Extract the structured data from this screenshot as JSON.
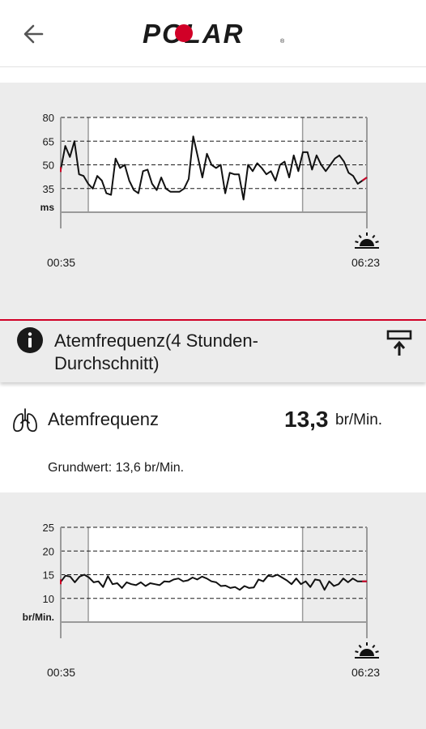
{
  "header": {
    "back_icon": "arrow-left-icon",
    "logo_text": "POLAR",
    "logo_color": "#1a1a1a",
    "logo_accent": "#d10027"
  },
  "hrv_chart": {
    "chart_data": {
      "type": "line",
      "ylabel": "ms",
      "yticks": [
        "80",
        "65",
        "50",
        "35"
      ],
      "ylim": [
        20,
        80
      ],
      "x_start_label": "00:35",
      "x_end_label": "06:23",
      "x_start_icon": "moon-icon",
      "x_end_icon": "sunrise-icon",
      "sleep_window_fraction": [
        0.09,
        0.79
      ],
      "values": [
        47,
        62,
        55,
        65,
        44,
        43,
        38,
        35,
        43,
        40,
        32,
        31,
        54,
        48,
        50,
        40,
        34,
        32,
        46,
        47,
        38,
        34,
        42,
        35,
        33,
        33,
        33,
        35,
        41,
        68,
        55,
        42,
        57,
        50,
        48,
        50,
        32,
        45,
        44,
        44,
        28,
        50,
        46,
        51,
        48,
        44,
        46,
        40,
        50,
        52,
        42,
        56,
        46,
        58,
        58,
        47,
        56,
        50,
        46,
        50,
        54,
        56,
        52,
        45,
        43,
        38,
        40,
        42
      ]
    }
  },
  "info_bar": {
    "info_icon": "info-circle-icon",
    "title": "Atemfrequenz(4 Stunden-Durchschnitt)",
    "collapse_icon": "collapse-up-icon"
  },
  "respiration": {
    "icon": "lungs-icon",
    "label": "Atemfrequenz",
    "value": "13,3",
    "unit": "br/Min.",
    "baseline": "Grundwert: 13,6 br/Min."
  },
  "resp_chart": {
    "chart_data": {
      "type": "line",
      "ylabel": "br/Min.",
      "yticks": [
        "25",
        "20",
        "15",
        "10"
      ],
      "ylim": [
        5,
        25
      ],
      "x_start_label": "00:35",
      "x_end_label": "06:23",
      "x_start_icon": "moon-icon",
      "x_end_icon": "sunrise-icon",
      "sleep_window_fraction": [
        0.09,
        0.79
      ],
      "values": [
        13.5,
        14.8,
        14.6,
        13.4,
        14.6,
        15.0,
        14.4,
        13.4,
        13.6,
        12.4,
        14.7,
        13.0,
        13.2,
        12.2,
        13.4,
        13.0,
        12.8,
        13.4,
        12.6,
        13.2,
        13.0,
        12.8,
        13.6,
        13.5,
        14.0,
        14.2,
        13.6,
        13.8,
        14.4,
        14.0,
        14.6,
        14.2,
        13.6,
        13.4,
        12.6,
        12.7,
        12.2,
        12.4,
        11.8,
        12.6,
        12.2,
        12.3,
        14.0,
        13.6,
        14.8,
        14.6,
        15.0,
        14.4,
        13.8,
        13.0,
        14.2,
        13.0,
        13.6,
        12.4,
        14.0,
        13.8,
        11.8,
        13.6,
        12.6,
        13.0,
        14.2,
        13.4,
        14.2,
        13.6,
        13.6,
        13.6
      ]
    }
  }
}
